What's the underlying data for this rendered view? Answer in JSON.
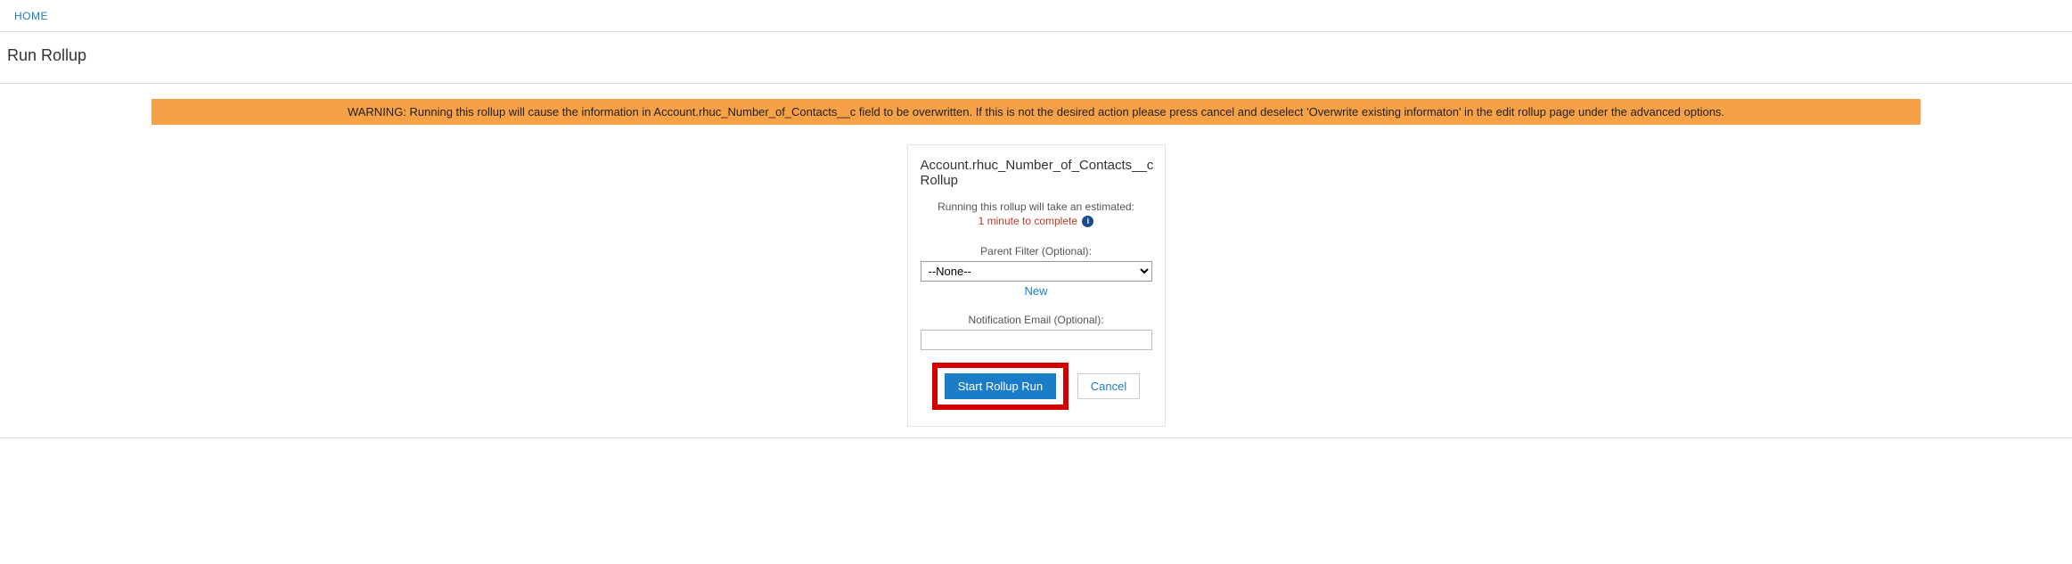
{
  "nav": {
    "home": "HOME"
  },
  "page_title": "Run Rollup",
  "warning": "WARNING: Running this rollup will cause the information in Account.rhuc_Number_of_Contacts__c field to be overwritten. If this is not the desired action please press cancel and deselect 'Overwrite existing informaton' in the edit rollup page under the advanced options.",
  "card": {
    "title": "Account.rhuc_Number_of_Contacts__c Rollup",
    "estimate_label": "Running this rollup will take an estimated:",
    "estimate_time": "1 minute to complete",
    "info_icon_char": "i",
    "parent_filter_label": "Parent Filter (Optional):",
    "parent_filter_value": "--None--",
    "new_link": "New",
    "notification_label": "Notification Email (Optional):",
    "notification_value": "",
    "start_button": "Start Rollup Run",
    "cancel_button": "Cancel"
  }
}
